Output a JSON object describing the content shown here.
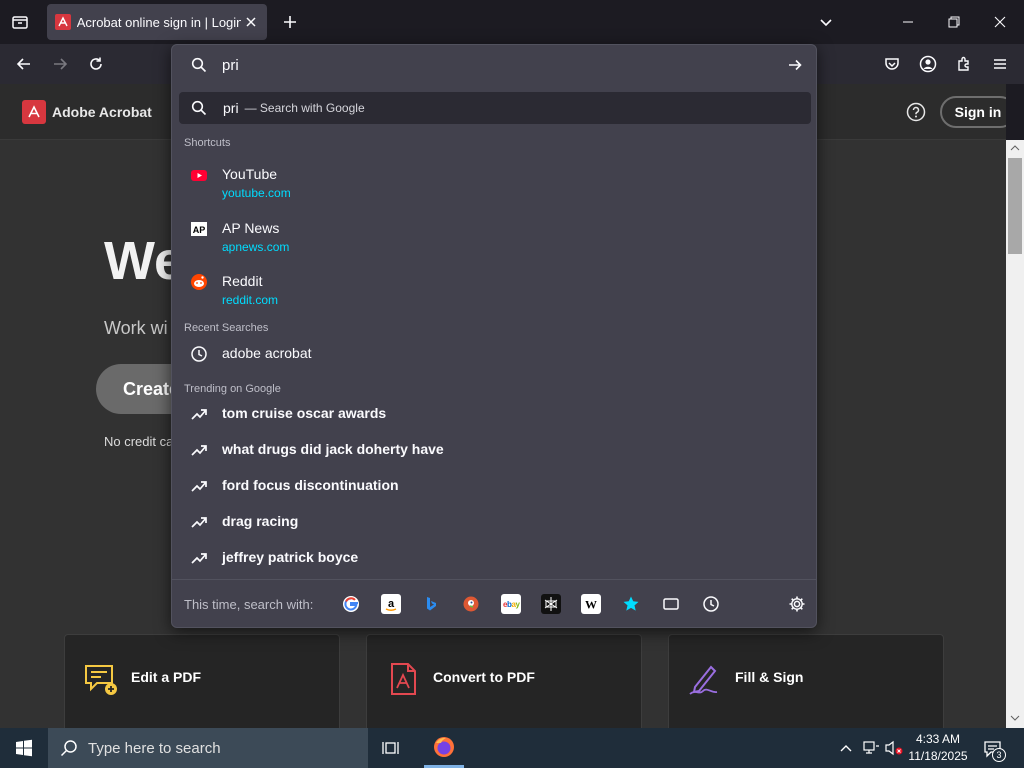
{
  "tab": {
    "title": "Acrobat online sign in | Login to"
  },
  "urlbar": {
    "value": "pri"
  },
  "suggestion": {
    "query": "pri",
    "suffix": "— Search with Google"
  },
  "shortcuts": {
    "header": "Shortcuts",
    "items": [
      {
        "name": "YouTube",
        "url": "youtube.com",
        "icon": "youtube-icon"
      },
      {
        "name": "AP News",
        "url": "apnews.com",
        "icon": "apnews-icon"
      },
      {
        "name": "Reddit",
        "url": "reddit.com",
        "icon": "reddit-icon"
      }
    ]
  },
  "recent": {
    "header": "Recent Searches",
    "items": [
      "adobe acrobat"
    ]
  },
  "trending": {
    "header": "Trending on Google",
    "items": [
      "tom cruise oscar awards",
      "what drugs did jack doherty have",
      "ford focus discontinuation",
      "drag racing",
      "jeffrey patrick boyce"
    ]
  },
  "oneoff": {
    "label": "This time, search with:",
    "engines": [
      "google",
      "amazon",
      "bing",
      "duckduckgo",
      "ebay",
      "perplexity",
      "wikipedia",
      "bookmarks",
      "tabs",
      "history"
    ]
  },
  "page": {
    "brand": "Adobe Acrobat",
    "signin": "Sign in",
    "hero_title": "We",
    "hero_sub": "Work wi",
    "hero_button": "Create",
    "no_credit": "No credit ca",
    "cards": [
      "Edit a PDF",
      "Convert to PDF",
      "Fill & Sign"
    ]
  },
  "taskbar": {
    "search_placeholder": "Type here to search",
    "time": "4:33 AM",
    "date": "11/18/2025",
    "notifications": "3"
  },
  "colors": {
    "accent_link": "#00ddff",
    "acrobat_red": "#d7373f",
    "panel_bg": "#42414d"
  }
}
